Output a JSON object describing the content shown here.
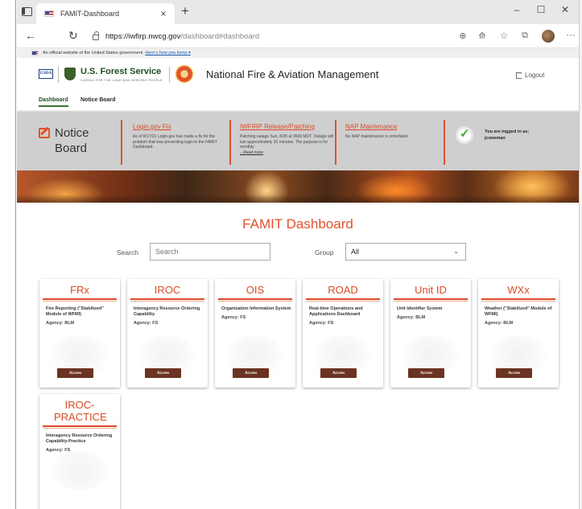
{
  "browser": {
    "tab_title": "FAMIT-Dashboard",
    "tab_close": "×",
    "new_tab": "+",
    "minimize": "‒",
    "maximize": "☐",
    "close": "✕",
    "back": "←",
    "reload": "↻",
    "url_host": "https://iwfirp.nwcg.gov",
    "url_path": "/dashboard#dashboard",
    "more": "···"
  },
  "gov_banner": {
    "text": "An official website of the United States government",
    "link": "Here's how you know ▾"
  },
  "header": {
    "usda": "USDA",
    "forest_service": "U.S. Forest Service",
    "forest_service_tagline": "CARING FOR THE LAND AND SERVING PEOPLE",
    "site_title": "National Fire & Aviation Management",
    "logout": "Logout"
  },
  "nav": {
    "items": [
      {
        "label": "Dashboard",
        "active": true
      },
      {
        "label": "Notice Board",
        "active": false
      }
    ]
  },
  "notice_board": {
    "title": "Notice Board",
    "notices": [
      {
        "title": "Login.gov Fix",
        "body": "As of 8/17/21 Login.gov has made a fix for the problem that was preventing login to the FAMIT Dashboard.",
        "more": ""
      },
      {
        "title": "IWFIRP Release/Patching",
        "body": "Patching outage Sun, 8/28 at 0500 MDT. Outage will last approximately 20 minutes. The purpose is for monthly",
        "more": "...Read more"
      },
      {
        "title": "NAP Maintenance",
        "body": "No NAP maintenance is scheduled.",
        "more": ""
      }
    ],
    "login_status": "You are logged in as: jconeman"
  },
  "dashboard": {
    "title": "FAMIT Dashboard",
    "search_label": "Search",
    "search_placeholder": "Search",
    "group_label": "Group",
    "group_value": "All",
    "access_label": "Access",
    "cards": [
      {
        "title": "FRx",
        "description": "Fire Reporting (\"Stabilized\" Module of WFMI)",
        "agency": "Agency: BLM"
      },
      {
        "title": "IROC",
        "description": "Interagency Resource Ordering Capability",
        "agency": "Agency: FS"
      },
      {
        "title": "OIS",
        "description": "Organization Information System",
        "agency": "Agency: FS"
      },
      {
        "title": "ROAD",
        "description": "Real-time Operations and Applications Dashboard",
        "agency": "Agency: FS"
      },
      {
        "title": "Unit ID",
        "description": "Unit Identifier System",
        "agency": "Agency: BLM"
      },
      {
        "title": "WXx",
        "description": "Weather (\"Stabilized\" Module of WFMI)",
        "agency": "Agency: BLM"
      },
      {
        "title": "IROC-PRACTICE",
        "description": "Interagency Resource Ordering Capability-Practice",
        "agency": "Agency: FS"
      }
    ]
  },
  "colors": {
    "accent": "#e0522b",
    "button": "#6b3321",
    "nav_active": "#3a6d35"
  }
}
